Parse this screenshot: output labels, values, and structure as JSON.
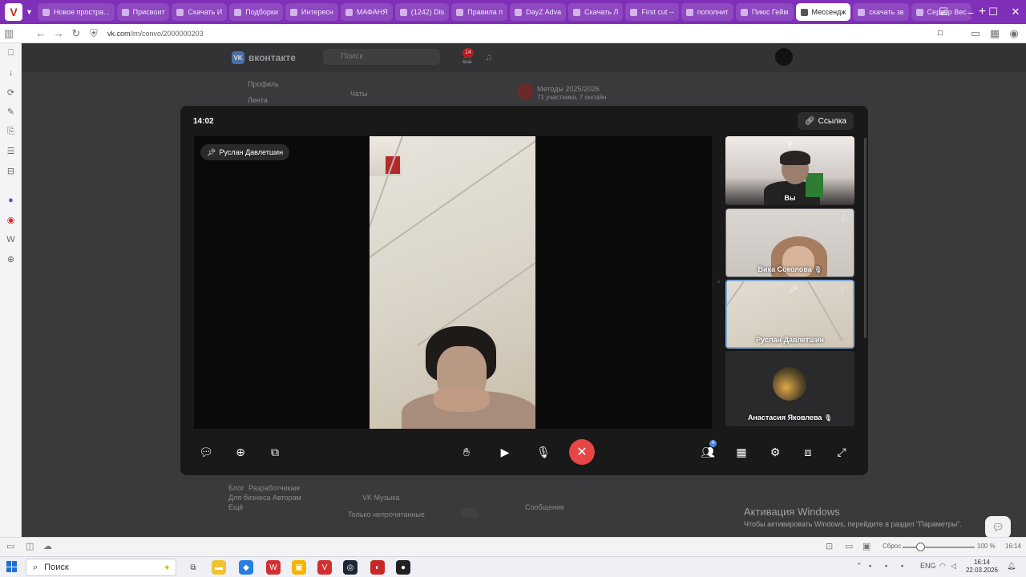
{
  "browser": {
    "tabs": [
      {
        "label": "Новое простра..."
      },
      {
        "label": "Присвоит"
      },
      {
        "label": "Скачать И"
      },
      {
        "label": "Подборки"
      },
      {
        "label": "Интересн"
      },
      {
        "label": "МАФАНЯ"
      },
      {
        "label": "(1242) Dis"
      },
      {
        "label": "Правила п"
      },
      {
        "label": "DayZ Adva"
      },
      {
        "label": "Скачать Л"
      },
      {
        "label": "First cut --"
      },
      {
        "label": "пополнит"
      },
      {
        "label": "Пиюс Гейм"
      },
      {
        "label": "Мессендж",
        "active": true
      },
      {
        "label": "скачать зв"
      },
      {
        "label": "Сервер Вес"
      }
    ],
    "new_tab_label": "+",
    "url_prefix": "vk.com",
    "url_path": "/im/convo/2000000203",
    "accent_color": "#7f2fb8"
  },
  "vk_page": {
    "brand": "вконтакте",
    "search_placeholder": "Поиск",
    "notif_count": "14",
    "nav_items": [
      "Профиль",
      "Лента"
    ],
    "chats_header": "Чаты",
    "conversation_title": "Методы 2025/2026",
    "conversation_sub": "71 участника, 7 онлайн",
    "bottom_item": "VK Музыка",
    "bottom_toggle_label": "Только непрочитанные",
    "message_placeholder": "Сообщение",
    "footer_links": [
      "Блог",
      "Разработчикам",
      "Для бизнеса",
      "Авторам",
      "Ещё"
    ]
  },
  "call": {
    "time": "14:02",
    "link_label": "Ссылка",
    "pinned_name": "Руслан Давлетшин",
    "participants": [
      {
        "name": "Вы",
        "muted": false
      },
      {
        "name": "Вика Соколова",
        "muted": true
      },
      {
        "name": "Руслан Давлетшин",
        "muted": false,
        "pinned": true
      },
      {
        "name": "Анастасия Яковлева",
        "muted": true
      }
    ],
    "participants_badge": "4",
    "hangup_color": "#e64646",
    "selected_tile_border": "#7fa7d6"
  },
  "watermark": {
    "title": "Активация Windows",
    "subtitle": "Чтобы активировать Windows, перейдите в раздел \"Параметры\"."
  },
  "statusbar": {
    "reset_label": "Сброс",
    "zoom": "100 %",
    "time": "16:14"
  },
  "taskbar": {
    "search_placeholder": "Поиск",
    "lang": "ENG",
    "clock_time": "16:14",
    "clock_date": "22.03.2026"
  }
}
